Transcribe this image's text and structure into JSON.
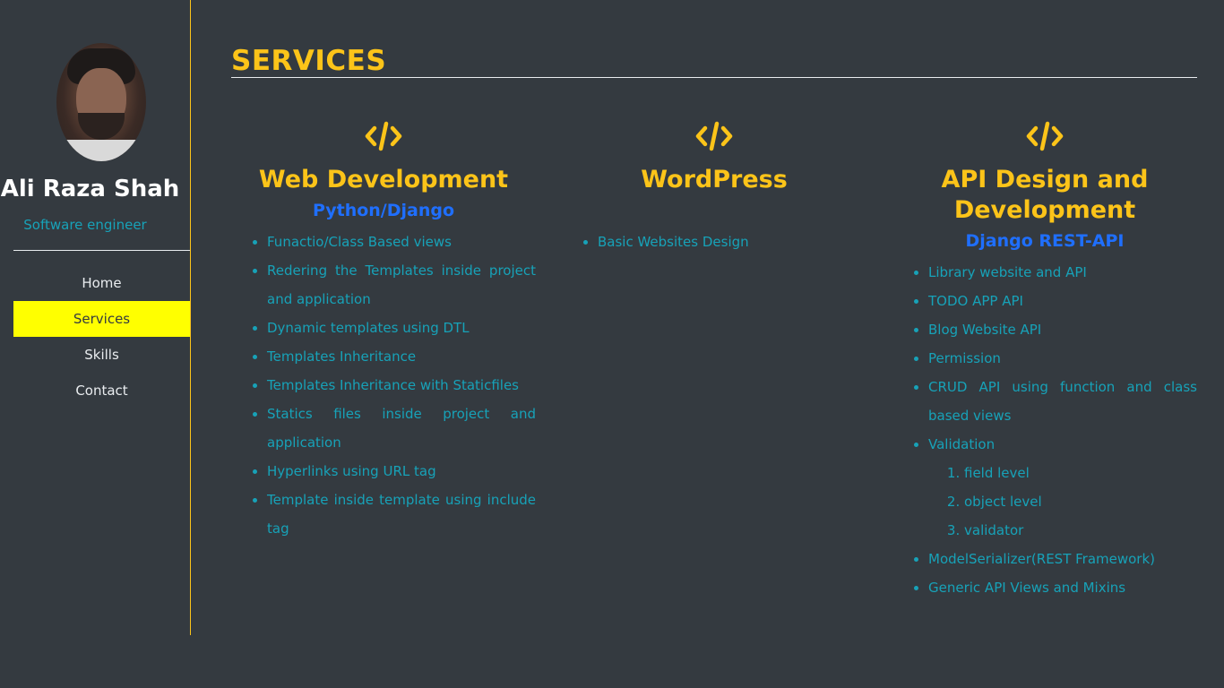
{
  "profile": {
    "name": "Ali Raza Shah",
    "role": "Software engineer"
  },
  "nav": {
    "items": [
      "Home",
      "Services",
      "Skills",
      "Contact"
    ],
    "active": "Services"
  },
  "section": {
    "title": "SERVICES"
  },
  "colors": {
    "background": "#343a40",
    "accent": "#fcc419",
    "subheading": "#1f6fff",
    "list_text": "#17a2b8",
    "nav_active": "#ffff00"
  },
  "services": [
    {
      "icon": "code-icon",
      "title": "Web Development",
      "subtitle": "Python/Django",
      "items": [
        "Funactio/Class Based views",
        "Redering the Templates inside project and application",
        "Dynamic templates using DTL",
        "Templates Inheritance",
        "Templates Inheritance with Staticfiles",
        "Statics files inside project and application",
        "Hyperlinks using URL tag",
        "Template inside template using include tag"
      ]
    },
    {
      "icon": "code-icon",
      "title": "WordPress",
      "subtitle": "",
      "items": [
        "Basic Websites Design"
      ]
    },
    {
      "icon": "code-icon",
      "title": "API Design and Development",
      "subtitle": "Django REST-API",
      "items": [
        "Library website and API",
        "TODO APP API",
        "Blog Website API",
        "Permission",
        "CRUD API using function and class based views",
        "Validation",
        "ModelSerializer(REST Framework)",
        "Generic API Views and Mixins"
      ],
      "validation_levels": [
        "field level",
        "object level",
        "validator"
      ]
    }
  ]
}
